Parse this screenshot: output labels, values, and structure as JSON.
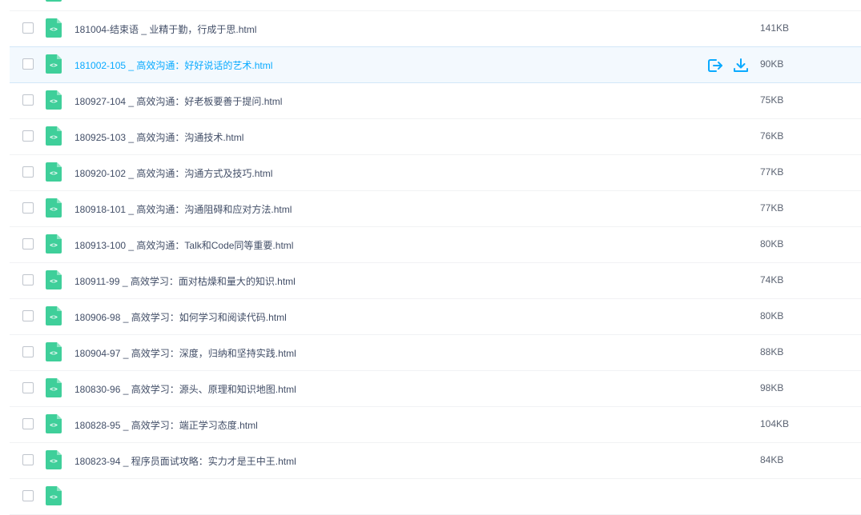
{
  "colors": {
    "accent": "#09aaff",
    "icon_green": "#3fcf9a",
    "hover_bg": "#f3f9fe"
  },
  "rows": [
    {
      "name": "",
      "size": "",
      "partial": "top"
    },
    {
      "name": "181004-结束语 _ 业精于勤，行成于思.html",
      "size": "141KB"
    },
    {
      "name": "181002-105 _ 高效沟通：好好说话的艺术.html",
      "size": "90KB",
      "hover": true
    },
    {
      "name": "180927-104 _ 高效沟通：好老板要善于提问.html",
      "size": "75KB"
    },
    {
      "name": "180925-103 _ 高效沟通：沟通技术.html",
      "size": "76KB"
    },
    {
      "name": "180920-102 _ 高效沟通：沟通方式及技巧.html",
      "size": "77KB"
    },
    {
      "name": "180918-101 _ 高效沟通：沟通阻碍和应对方法.html",
      "size": "77KB"
    },
    {
      "name": "180913-100 _ 高效沟通：Talk和Code同等重要.html",
      "size": "80KB"
    },
    {
      "name": "180911-99 _ 高效学习：面对枯燥和量大的知识.html",
      "size": "74KB"
    },
    {
      "name": "180906-98 _ 高效学习：如何学习和阅读代码.html",
      "size": "80KB"
    },
    {
      "name": "180904-97 _ 高效学习：深度，归纳和坚持实践.html",
      "size": "88KB"
    },
    {
      "name": "180830-96 _ 高效学习：源头、原理和知识地图.html",
      "size": "98KB"
    },
    {
      "name": "180828-95 _ 高效学习：端正学习态度.html",
      "size": "104KB"
    },
    {
      "name": "180823-94 _ 程序员面试攻略：实力才是王中王.html",
      "size": "84KB"
    },
    {
      "name": "",
      "size": "",
      "partial": "bottom"
    }
  ],
  "hover_actions": [
    {
      "icon": "share-out-icon"
    },
    {
      "icon": "download-icon"
    }
  ]
}
